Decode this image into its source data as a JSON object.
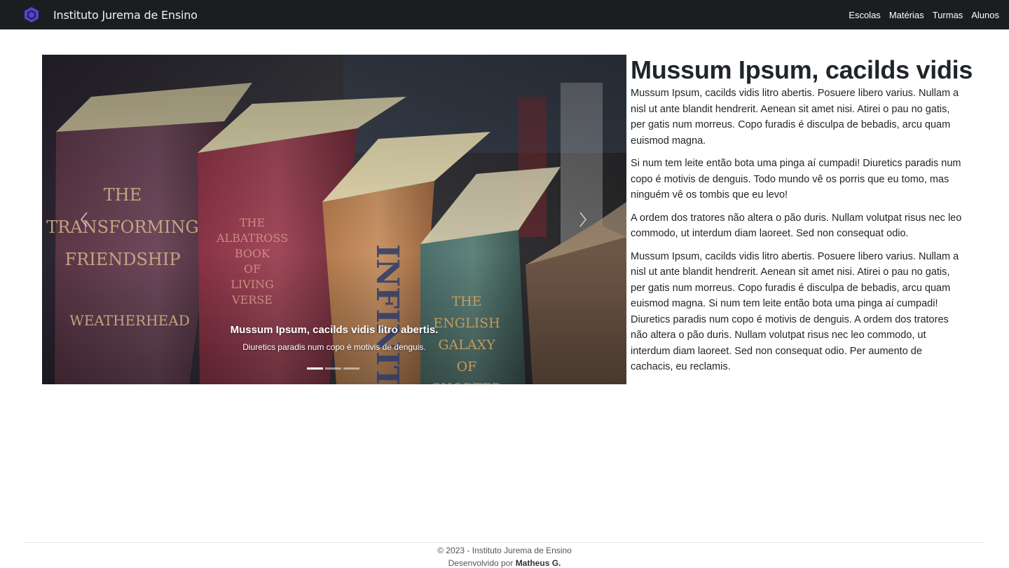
{
  "navbar": {
    "brand": "Instituto Jurema de Ensino",
    "links": [
      "Escolas",
      "Matérias",
      "Turmas",
      "Alunos"
    ]
  },
  "carousel": {
    "caption_title": "Mussum Ipsum, cacilds vidis litro abertis.",
    "caption_text": "Diuretics paradis num copo é motivis de denguis.",
    "slide_count": 3,
    "active_slide": 1
  },
  "content": {
    "title": "Mussum Ipsum, cacilds vidis",
    "paragraphs": [
      "Mussum Ipsum, cacilds vidis litro abertis. Posuere libero varius. Nullam a nisl ut ante blandit hendrerit. Aenean sit amet nisi. Atirei o pau no gatis, per gatis num morreus. Copo furadis é disculpa de bebadis, arcu quam euismod magna.",
      "Si num tem leite então bota uma pinga aí cumpadi! Diuretics paradis num copo é motivis de denguis. Todo mundo vê os porris que eu tomo, mas ninguém vê os tombis que eu levo!",
      "A ordem dos tratores não altera o pão duris. Nullam volutpat risus nec leo commodo, ut interdum diam laoreet. Sed non consequat odio.",
      "Mussum Ipsum, cacilds vidis litro abertis. Posuere libero varius. Nullam a nisl ut ante blandit hendrerit. Aenean sit amet nisi. Atirei o pau no gatis, per gatis num morreus. Copo furadis é disculpa de bebadis, arcu quam euismod magna. Si num tem leite então bota uma pinga aí cumpadi! Diuretics paradis num copo é motivis de denguis. A ordem dos tratores não altera o pão duris. Nullam volutpat risus nec leo commodo, ut interdum diam laoreet. Sed non consequat odio. Per aumento de cachacis, eu reclamis."
    ]
  },
  "footer": {
    "copyright": "© 2023 - Instituto Jurema de Ensino",
    "developed_by_prefix": "Desenvolvido por",
    "developer": "Matheus G."
  },
  "book_spines": {
    "book1": [
      "THE",
      "TRANSFORMING",
      "FRIENDSHIP",
      "WEATHERHEAD"
    ],
    "book2": [
      "THE",
      "ALBATROSS",
      "BOOK",
      "OF",
      "LIVING",
      "VERSE"
    ],
    "book3": "INFINITE",
    "book4": [
      "THE",
      "ENGLISH",
      "GALAXY",
      "OF",
      "SHORTER"
    ]
  },
  "icons": {
    "brand": "hexagon-logo-icon",
    "prev": "chevron-left-icon",
    "next": "chevron-right-icon"
  },
  "colors": {
    "navbar_bg": "#1b1e21",
    "brand_logo": "#6f42c1",
    "text": "#212529"
  }
}
